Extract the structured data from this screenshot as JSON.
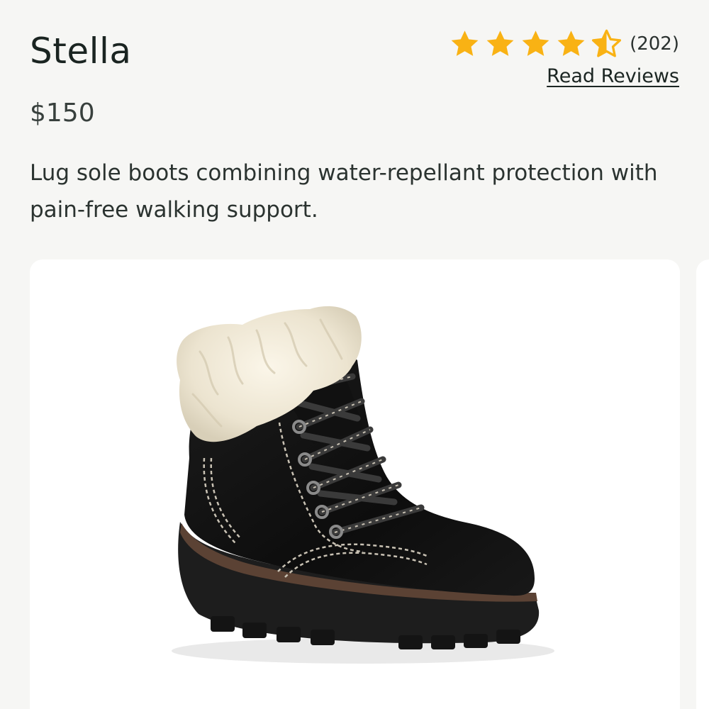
{
  "product": {
    "name": "Stella",
    "price": "$150",
    "description": "Lug sole boots combining water-repellant protection with pain-free walking support."
  },
  "rating": {
    "value": 4.5,
    "max": 5,
    "count_label": "(202)",
    "read_reviews_label": "Read Reviews",
    "star_color": "#f9b214"
  },
  "image": {
    "icon": "boot-product-image"
  }
}
